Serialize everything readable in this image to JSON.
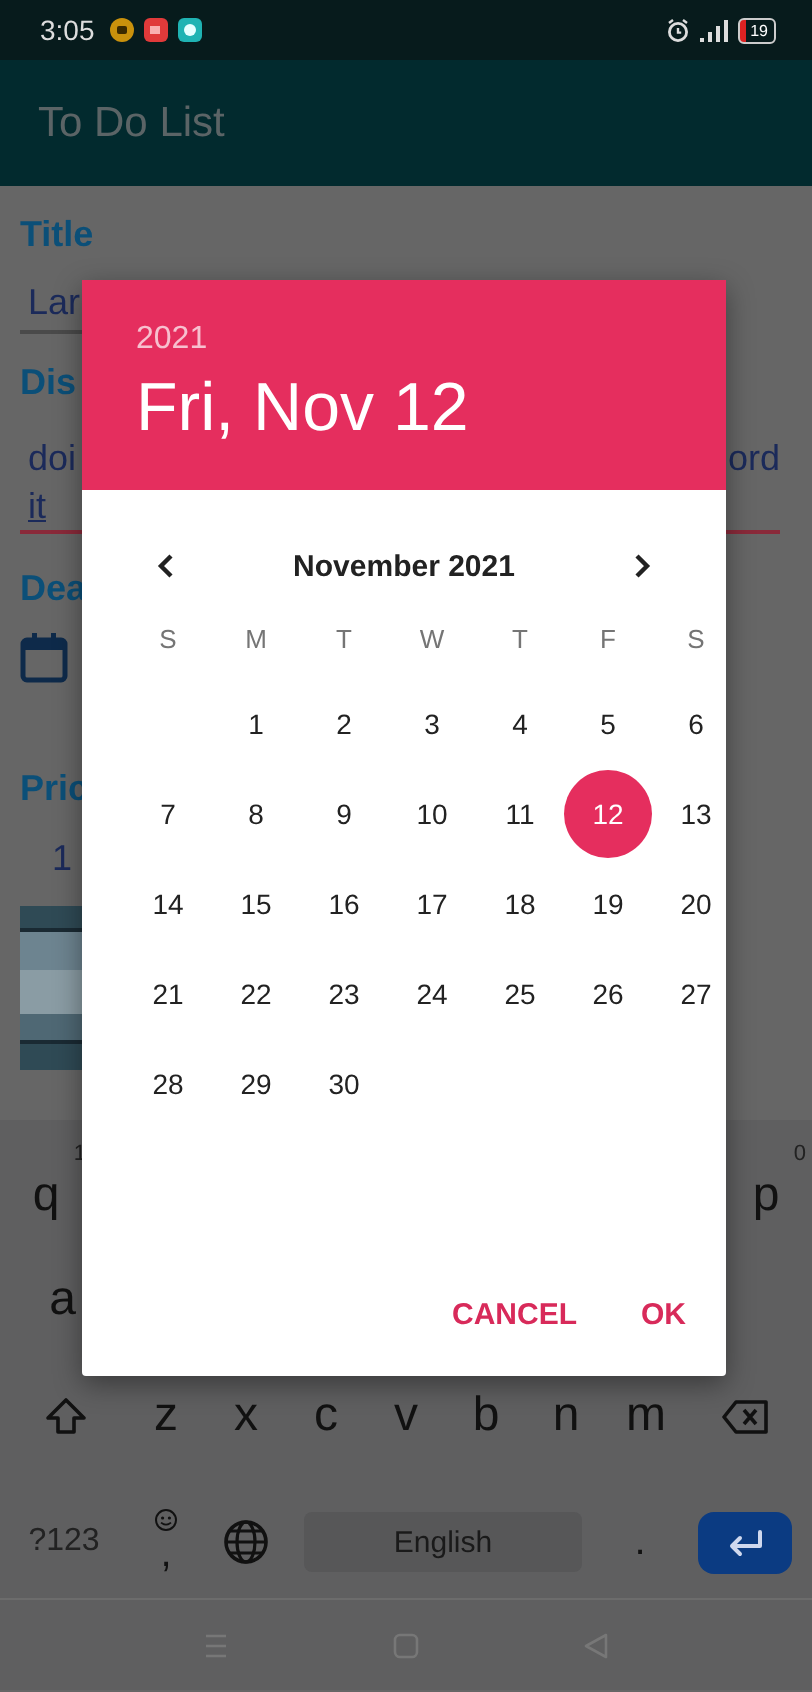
{
  "status_bar": {
    "time": "3:05",
    "battery": "19"
  },
  "app_bar": {
    "title": "To Do List"
  },
  "form": {
    "title_label": "Title",
    "title_value": "Lar",
    "description_label": "Dis",
    "description_line_1_start": "doi",
    "description_line_1_end": "ord",
    "description_line_2": "it",
    "deadline_label": "Dea",
    "price_label": "Pric",
    "price_value": "1"
  },
  "keyboard": {
    "rows": [
      {
        "keys": [
          {
            "kind": "letter",
            "label": "q",
            "hint": "1"
          },
          {
            "kind": "letter",
            "label": "p",
            "hint": "0"
          }
        ]
      },
      {
        "keys": [
          {
            "kind": "letter",
            "label": "a"
          }
        ]
      },
      {
        "keys": [
          {
            "kind": "shift"
          },
          {
            "kind": "letter",
            "label": "z"
          },
          {
            "kind": "letter",
            "label": "x"
          },
          {
            "kind": "letter",
            "label": "c"
          },
          {
            "kind": "letter",
            "label": "v"
          },
          {
            "kind": "letter",
            "label": "b"
          },
          {
            "kind": "letter",
            "label": "n"
          },
          {
            "kind": "letter",
            "label": "m"
          },
          {
            "kind": "backspace"
          }
        ]
      },
      {
        "keys": [
          {
            "kind": "symbols",
            "label": "?123"
          },
          {
            "kind": "comma",
            "label": ","
          },
          {
            "kind": "globe"
          },
          {
            "kind": "space",
            "label": "English"
          },
          {
            "kind": "period",
            "label": "."
          },
          {
            "kind": "enter"
          }
        ]
      }
    ]
  },
  "date_picker": {
    "year": "2021",
    "date": "Fri, Nov 12",
    "month": "November 2021",
    "weekdays": [
      "S",
      "M",
      "T",
      "W",
      "T",
      "F",
      "S"
    ],
    "weeks": [
      [
        {
          "label": "1",
          "selected": false
        },
        {
          "label": "2",
          "selected": false
        },
        {
          "label": "3",
          "selected": false
        },
        {
          "label": "4",
          "selected": false
        },
        {
          "label": "5",
          "selected": false
        },
        {
          "label": "6",
          "selected": false
        }
      ],
      [
        {
          "label": "7",
          "selected": false
        },
        {
          "label": "8",
          "selected": false
        },
        {
          "label": "9",
          "selected": false
        },
        {
          "label": "10",
          "selected": false
        },
        {
          "label": "11",
          "selected": false
        },
        {
          "label": "12",
          "selected": true
        },
        {
          "label": "13",
          "selected": false
        }
      ],
      [
        {
          "label": "14",
          "selected": false
        },
        {
          "label": "15",
          "selected": false
        },
        {
          "label": "16",
          "selected": false
        },
        {
          "label": "17",
          "selected": false
        },
        {
          "label": "18",
          "selected": false
        },
        {
          "label": "19",
          "selected": false
        },
        {
          "label": "20",
          "selected": false
        }
      ],
      [
        {
          "label": "21",
          "selected": false
        },
        {
          "label": "22",
          "selected": false
        },
        {
          "label": "23",
          "selected": false
        },
        {
          "label": "24",
          "selected": false
        },
        {
          "label": "25",
          "selected": false
        },
        {
          "label": "26",
          "selected": false
        },
        {
          "label": "27",
          "selected": false
        }
      ],
      [
        {
          "label": "28",
          "selected": false
        },
        {
          "label": "29",
          "selected": false
        },
        {
          "label": "30",
          "selected": false
        }
      ]
    ],
    "actions": [
      "CANCEL",
      "OK"
    ]
  }
}
